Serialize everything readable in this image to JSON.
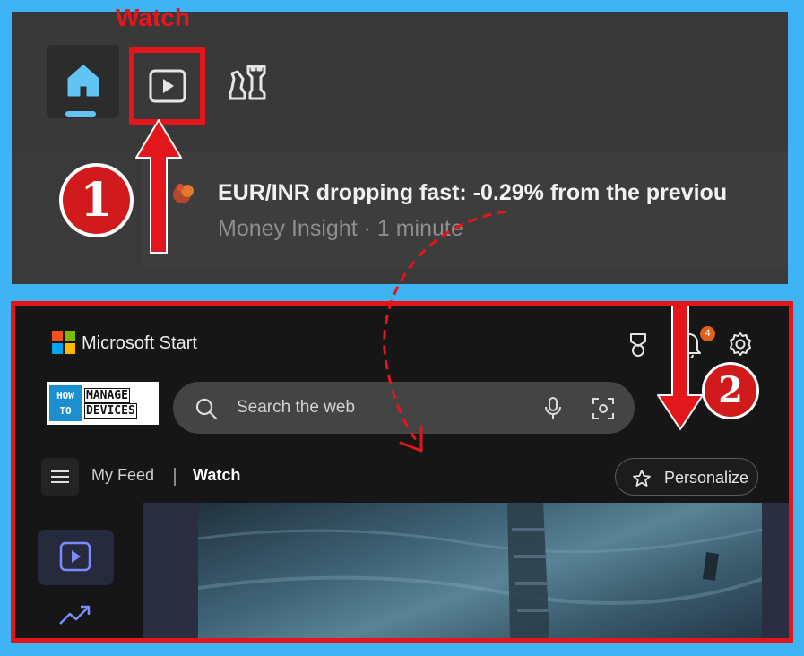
{
  "top": {
    "caption": "Watch",
    "tabs": [
      {
        "name": "home",
        "icon": "home-icon"
      },
      {
        "name": "watch",
        "icon": "play-icon"
      },
      {
        "name": "games",
        "icon": "chess-icon"
      }
    ],
    "news": {
      "title": "EUR/INR dropping fast: -0.29% from the previou",
      "meta": "Money Insight · 1 minute"
    },
    "step": "1"
  },
  "bottom": {
    "brand": "Microsoft Start",
    "notification_count": "4",
    "logo": {
      "left_lines": [
        "HOW",
        "TO"
      ],
      "right_lines": [
        "MANAGE",
        "DEVICES"
      ]
    },
    "search": {
      "placeholder": "Search the web"
    },
    "nav": {
      "my_feed": "My Feed",
      "watch": "Watch"
    },
    "personalize": "Personalize",
    "step": "2"
  },
  "colors": {
    "background": "#3fb4f4",
    "highlight_red": "#e3161b",
    "home_accent": "#62c4f2",
    "badge_orange": "#e1601b"
  }
}
